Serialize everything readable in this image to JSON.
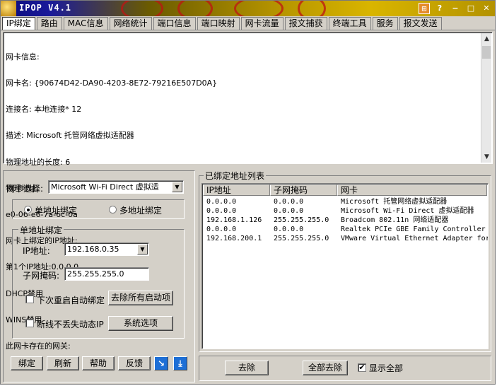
{
  "window": {
    "title": "IPOP V4.1",
    "controls": {
      "menu": "⊞",
      "help": "?",
      "minimize": "−",
      "maximize": "□",
      "close": "✕"
    }
  },
  "tabs": [
    {
      "label": "IP绑定",
      "active": true
    },
    {
      "label": "路由"
    },
    {
      "label": "MAC信息"
    },
    {
      "label": "网络统计"
    },
    {
      "label": "端口信息"
    },
    {
      "label": "端口映射"
    },
    {
      "label": "网卡流量"
    },
    {
      "label": "报文捕获"
    },
    {
      "label": "终端工具"
    },
    {
      "label": "服务"
    },
    {
      "label": "报文发送"
    }
  ],
  "info_lines": [
    "网卡信息:",
    "网卡名: {90674D42-DA90-4203-8E72-79216E507D0A}",
    "连接名: 本地连接* 12",
    "描述: Microsoft 托管网络虚拟适配器",
    "物理地址的长度: 6",
    "物理地址:",
    "e0-06-e6-7a-6c-0a",
    "网卡上绑定的IP地址:",
    "第1个IP地址:0.0.0.0",
    "DHCP禁用",
    "WINS禁用",
    "此网卡存在的网关:"
  ],
  "left": {
    "adapter_label": "网卡选择:",
    "adapter_value": "Microsoft Wi-Fi Direct 虚拟适",
    "radio_single": "单地址绑定",
    "radio_multi": "多地址绑定",
    "group_title": "单地址绑定",
    "ip_label": "IP地址:",
    "ip_value": "192.168.0.35",
    "mask_label": "子网掩码:",
    "mask_value": "255.255.255.0",
    "auto_bind_label": "下次重启自动绑定",
    "remove_all_button": "去除所有启动项",
    "keep_dhcp_label": "断线不丢失动态IP",
    "system_options_button": "系统选项",
    "buttons": {
      "bind": "绑定",
      "refresh": "刷新",
      "help": "帮助",
      "feedback": "反馈"
    }
  },
  "right": {
    "group_title": "已绑定地址列表",
    "columns": [
      "IP地址",
      "子网掩码",
      "网卡"
    ],
    "rows": [
      [
        "0.0.0.0",
        "0.0.0.0",
        "Microsoft 托管网络虚拟适配器"
      ],
      [
        "0.0.0.0",
        "0.0.0.0",
        "Microsoft Wi-Fi Direct 虚拟适配器"
      ],
      [
        "192.168.1.126",
        "255.255.255.0",
        "Broadcom 802.11n 网络适配器"
      ],
      [
        "0.0.0.0",
        "0.0.0.0",
        "Realtek PCIe GBE Family Controller"
      ],
      [
        "192.168.200.1",
        "255.255.255.0",
        "VMware Virtual Ethernet Adapter for"
      ]
    ],
    "remove_button": "去除",
    "remove_all_button": "全部去除",
    "show_all_label": "显示全部",
    "show_all_checked": true
  },
  "icons": {
    "arrow_down_right": "↘",
    "download": "⤓",
    "combo_arrow": "▼"
  }
}
